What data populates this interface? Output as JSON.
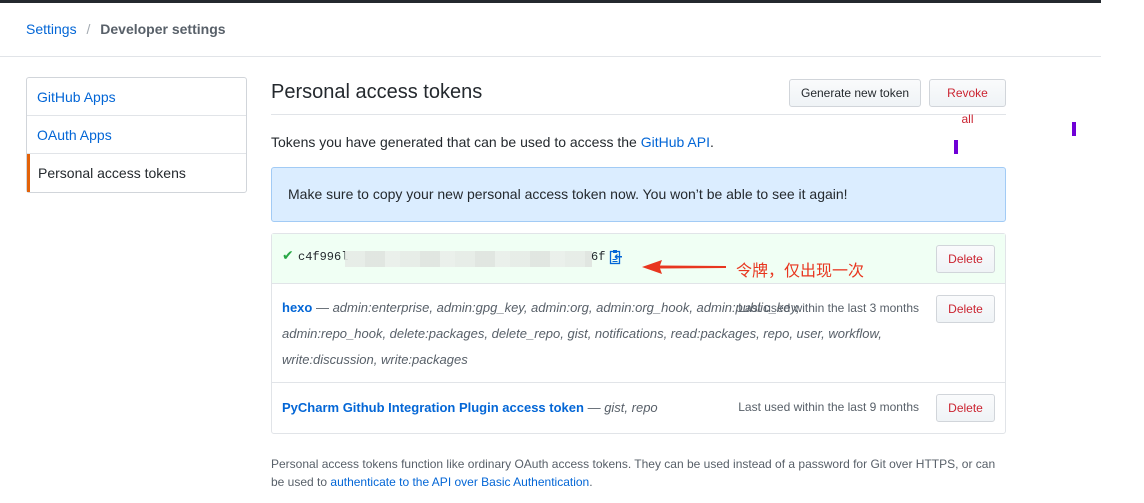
{
  "breadcrumb": {
    "root": "Settings",
    "separator": "/",
    "current": "Developer settings"
  },
  "sidebar": {
    "items": [
      {
        "label": "GitHub Apps"
      },
      {
        "label": "OAuth Apps"
      },
      {
        "label": "Personal access tokens"
      }
    ]
  },
  "main": {
    "title": "Personal access tokens",
    "generate_label": "Generate new token",
    "revoke_label": "Revoke all",
    "intro_text": "Tokens you have generated that can be used to access the ",
    "intro_link": "GitHub API",
    "intro_end": ".",
    "flash": "Make sure to copy your new personal access token now. You won’t be able to see it again!"
  },
  "tokens": {
    "new_token": {
      "prefix": "c4f996l",
      "suffix": "6f",
      "delete_label": "Delete",
      "check_icon": "check-icon",
      "copy_icon": "clipboard-icon"
    },
    "list": [
      {
        "name": "hexo",
        "dash": " — ",
        "scopes": "admin:enterprise, admin:gpg_key, admin:org, admin:org_hook, admin:public_key, admin:repo_hook, delete:packages, delete_repo, gist, notifications, read:packages, repo, user, workflow, write:discussion, write:packages",
        "last_used": "Last used within the last 3 months",
        "delete_label": "Delete"
      },
      {
        "name": "PyCharm Github Integration Plugin access token",
        "dash": " — ",
        "scopes": "gist, repo",
        "last_used": "Last used within the last 9 months",
        "delete_label": "Delete"
      }
    ]
  },
  "footnote": {
    "text": "Personal access tokens function like ordinary OAuth access tokens. They can be used instead of a password for Git over HTTPS, or can be used to ",
    "link": "authenticate to the API over Basic Authentication",
    "end": "."
  },
  "annotation": {
    "text": "令牌，仅出现一次",
    "color": "#e8361f"
  },
  "colors": {
    "link": "#0366d6",
    "danger": "#cb2431",
    "accent": "#e36209",
    "success": "#28a745"
  }
}
